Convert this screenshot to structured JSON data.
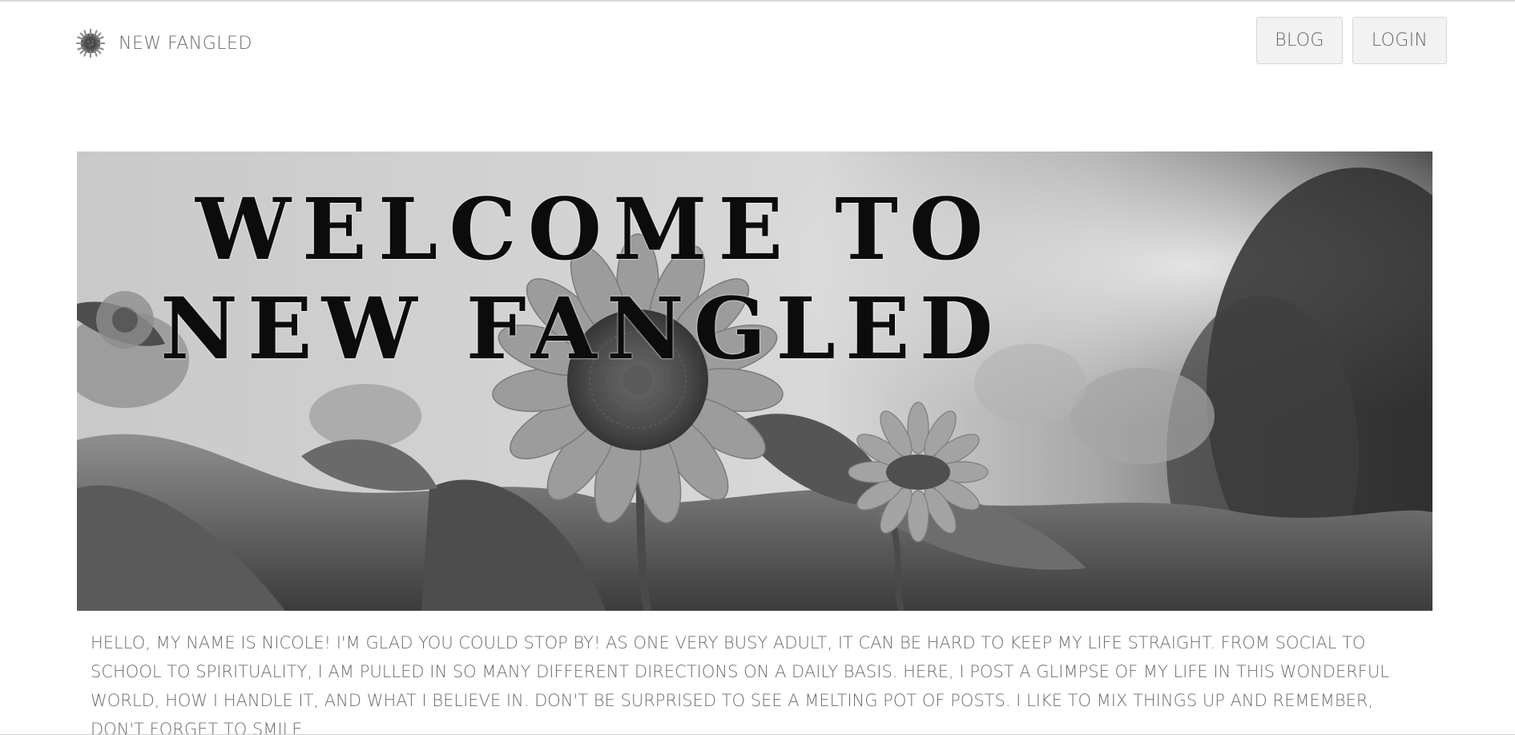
{
  "header": {
    "brand_icon": "sunflower-logo-icon",
    "brand_name": "NEW FANGLED",
    "nav": [
      {
        "label": "BLOG"
      },
      {
        "label": "LOGIN"
      }
    ]
  },
  "hero": {
    "image": "sunflower-field-grayscale",
    "title_line_1": "WELCOME TO",
    "title_line_2": "NEW FANGLED"
  },
  "intro": {
    "text": "HELLO, MY NAME IS NICOLE! I'M GLAD YOU COULD STOP BY! AS ONE VERY BUSY ADULT, IT CAN BE HARD TO KEEP MY LIFE STRAIGHT. FROM SOCIAL TO SCHOOL TO SPIRITUALITY, I AM PULLED IN SO MANY DIFFERENT DIRECTIONS ON A DAILY BASIS. HERE, I POST A GLIMPSE OF MY LIFE IN THIS WONDERFUL WORLD, HOW I HANDLE IT, AND WHAT I BELIEVE IN. DON'T BE SURPRISED TO SEE A MELTING POT OF POSTS. I LIKE TO MIX THINGS UP AND REMEMBER, DON'T FORGET TO SMILE"
  }
}
